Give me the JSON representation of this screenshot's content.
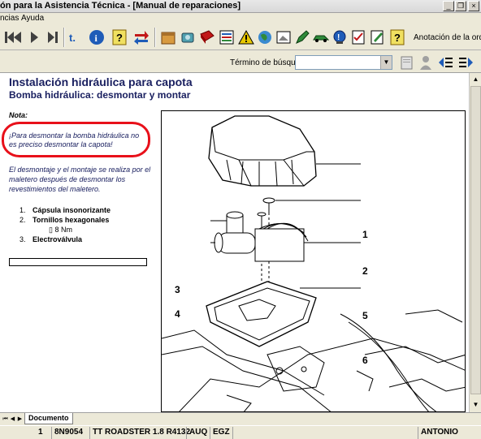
{
  "window": {
    "title": "ón para la Asistencia Técnica - [Manual de reparaciones]",
    "minimize": "_",
    "restore": "❐",
    "close": "×"
  },
  "menu": {
    "items": [
      "ncias",
      "Ayuda"
    ]
  },
  "toolbar": {
    "annotation_label": "Anotación de la orden c",
    "icons": [
      "first-page-icon",
      "prev-page-icon",
      "next-page-icon",
      "last-page-icon",
      "return-icon",
      "info-icon",
      "help-icon",
      "swap-icon",
      "package-icon",
      "engine-icon",
      "book-icon",
      "list-icon",
      "warning-icon",
      "globe-icon",
      "page-icon",
      "pen-icon",
      "car-icon",
      "bookmark-icon",
      "checklist-icon",
      "print-icon",
      "help-book-icon"
    ],
    "colors": {
      "accent_blue": "#1f5cb8",
      "green": "#2f8a3a",
      "red": "#c21818",
      "yellow": "#e8c800"
    }
  },
  "search": {
    "label": "Término de búsqueda:",
    "value": ""
  },
  "document": {
    "title": "Instalación hidráulica para capota",
    "subtitle": "Bomba hidráulica: desmontar y montar",
    "note_heading": "Nota:",
    "note_text": "¡Para desmontar la bomba hidráulica no es preciso desmontar la capota!",
    "paragraph": "El desmontaje y el montaje se realiza por el maletero después de desmontar los revestimientos del maletero.",
    "items": [
      {
        "num": "1.",
        "label": "Cápsula insonorizante"
      },
      {
        "num": "2.",
        "label": "Tornillos hexagonales",
        "sub": "8 Nm"
      },
      {
        "num": "3.",
        "label": "Electroválvula"
      }
    ],
    "sub_bullet": "▯",
    "highlight_color": "#e8101a",
    "text_color": "#1a2060"
  },
  "figure": {
    "callouts": [
      "1",
      "2",
      "3",
      "4",
      "5",
      "6"
    ]
  },
  "tabs": {
    "document_tab": "Documento"
  },
  "status": {
    "page": "1",
    "code": "8N9054",
    "model": "TT ROADSTER 1.8 R4132",
    "engine": "AUQ",
    "gearbox": "EGZ",
    "user": "ANTONIO"
  }
}
